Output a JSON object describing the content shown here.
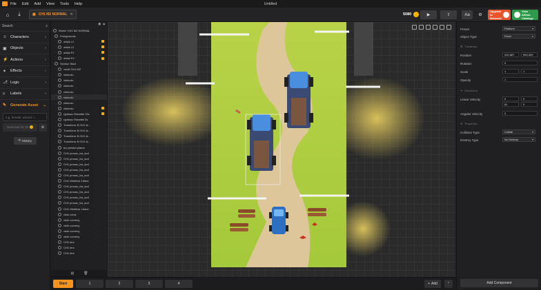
{
  "menu": {
    "items": [
      "File",
      "Edit",
      "Add",
      "View",
      "Tools",
      "Help"
    ],
    "window_title": "Untitled"
  },
  "tab": {
    "label": "CH1 M2 NORMAL"
  },
  "toolbar": {
    "coins": "5080",
    "aa_label": "Aa",
    "promo_upgrade": "Upgrade to Network!",
    "promo_catalogs": "View Affinia Catalogs"
  },
  "leftnav": {
    "search_label": "Search",
    "items": [
      {
        "label": "Characters",
        "icon": "person-icon"
      },
      {
        "label": "Objects",
        "icon": "cube-icon"
      },
      {
        "label": "Actions",
        "icon": "bolt-icon"
      },
      {
        "label": "Effects",
        "icon": "sparkle-icon"
      },
      {
        "label": "Logic",
        "icon": "logic-icon"
      },
      {
        "label": "Labels",
        "icon": "tag-icon"
      }
    ],
    "generate": {
      "label": "Generate Asset",
      "placeholder": "e.g. female, wizard, r...",
      "button": "Generate for 20",
      "history": "History"
    }
  },
  "hierarchy": {
    "rows": [
      "World: CH1 M2 NORMAL",
      "Foregrounds",
      "oblak L1",
      "oblak L2",
      "oblak P1",
      "oblak P2",
      "Section Start",
      "zmeli CH1 M2",
      "vketcolc",
      "vketcolc",
      "vketcolc",
      "vketcolc",
      "vketcolc",
      "vketcolc",
      "vketcolc",
      "rypttusc Retadtel 13s",
      "rypttusc Retadtel 3s",
      "Transform 3i CH1 sl...",
      "Transform 3i CH1 sl...",
      "Transform 3i CH1 sl...",
      "Transform 3i CH1 sl...",
      "tux prestet plame",
      "CH1 prosac_tra_sud",
      "CH1 prosac_tra_sud",
      "CH1 prosac_tra_sud",
      "CH1 prosac_tra_sud",
      "CH1 prosac_tra_sud",
      "CH1 Wedless 15ane",
      "CH1 prosac_tra_sud",
      "CH1 prosac_tra_sud",
      "CH1 prosac_tra_sud",
      "CH1 prosac_tra_sud",
      "CH1 Wedless 15ane",
      "vtuik cornL",
      "vtuik corveny",
      "vtuik corveny",
      "vtuik corveny",
      "vtuik corveny",
      "CH1 terc",
      "CH1 terc",
      "CH1 terc"
    ]
  },
  "properties": {
    "preset": {
      "label": "Preset",
      "value": "Platform"
    },
    "object_type": {
      "label": "Object Type",
      "value": "Fixed"
    },
    "transform_label": "Transform",
    "position": {
      "label": "Position",
      "x": "252.687",
      "y": "953.309"
    },
    "rotation": {
      "label": "Rotation",
      "value": "0"
    },
    "scale": {
      "label": "Scale",
      "x": "1",
      "y": "1"
    },
    "opacity": {
      "label": "Opacity",
      "value": "1"
    },
    "movement_label": "Movement",
    "linear_velocity": {
      "label": "Linear Velocity",
      "x": "0",
      "y": "0",
      "x2": "61",
      "y2": "0"
    },
    "angular_velocity": {
      "label": "Angular Velocity",
      "value": "0"
    },
    "properties_label": "Properties",
    "collision_type": {
      "label": "Collision Type",
      "value": "Collide"
    },
    "destroy_type": {
      "label": "Destroy Type",
      "value": "No Destroy"
    },
    "add_component": "Add Component"
  },
  "bottombar": {
    "tabs": [
      "Start",
      "1",
      "2",
      "3",
      "4"
    ],
    "add_label": "Add"
  }
}
